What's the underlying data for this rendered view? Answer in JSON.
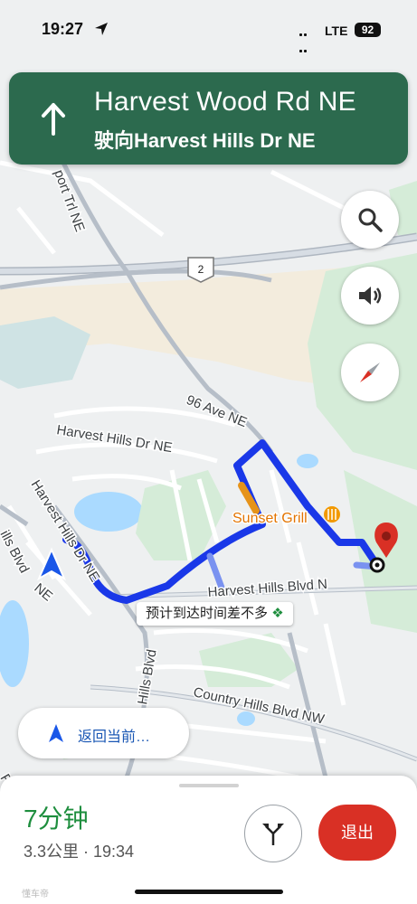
{
  "status_bar": {
    "time": "19:27",
    "network": "LTE",
    "battery": "92"
  },
  "navigation": {
    "street": "Harvest Wood Rd NE",
    "towards": "驶向Harvest Hills Dr NE"
  },
  "map_labels": {
    "road_upper_left": "port Trl NE",
    "highway_shield": "2",
    "road_96_ave": "96 Ave NE",
    "road_harvest_hills_dr_top": "Harvest Hills Dr NE",
    "road_harvest_hills_dr_left": "Harvest Hills Dr NE",
    "road_harvest_hills_blvd_left": "ills Blvd",
    "road_ne_left": "NE",
    "poi": "Sunset Grill",
    "road_harvest_hills_blvd": "Harvest Hills Blvd N",
    "road_hills_blvd_vertical": "Hills Blvd",
    "road_country_hills": "Country Hills Blvd NW",
    "road_left_bottom": "R"
  },
  "eta_chip": "预计到达时间差不多",
  "recenter_label": "返回当前…",
  "trip": {
    "duration": "7分钟",
    "distance_time": "3.3公里 · 19:34"
  },
  "exit_label": "退出",
  "watermark": "懂车帝",
  "colors": {
    "banner": "#2c6a4e",
    "route": "#1a38e8",
    "exit": "#d93025",
    "duration": "#1e8e3e"
  }
}
